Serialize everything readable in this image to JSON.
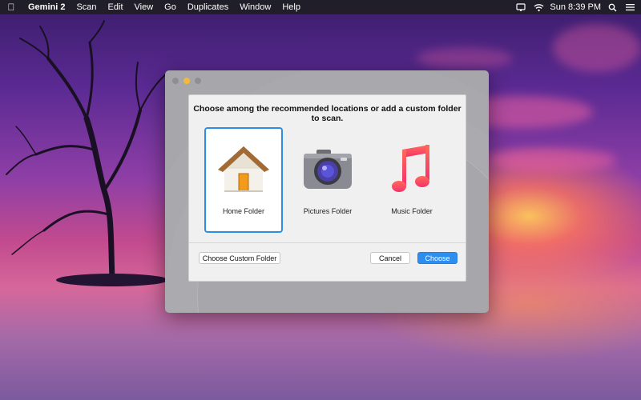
{
  "menubar": {
    "apple_icon": "apple-logo-icon",
    "app_name": "Gemini 2",
    "items": [
      "Scan",
      "Edit",
      "View",
      "Go",
      "Duplicates",
      "Window",
      "Help"
    ],
    "right_icons": [
      "display-icon",
      "wifi-icon",
      "search-icon",
      "list-icon"
    ],
    "clock": "Sun 8:39 PM"
  },
  "dialog": {
    "title": "Choose among the recommended locations or add a custom folder to scan.",
    "locations": [
      {
        "label": "Home Folder",
        "icon": "home-folder-icon",
        "selected": true
      },
      {
        "label": "Pictures Folder",
        "icon": "camera-icon",
        "selected": false
      },
      {
        "label": "Music Folder",
        "icon": "music-note-icon",
        "selected": false
      }
    ],
    "buttons": {
      "custom": "Choose Custom Folder",
      "cancel": "Cancel",
      "choose": "Choose"
    }
  },
  "colors": {
    "accent": "#2e8ef0",
    "selection_border": "#2b8fe6",
    "traffic_minimize": "#f4b93a"
  }
}
